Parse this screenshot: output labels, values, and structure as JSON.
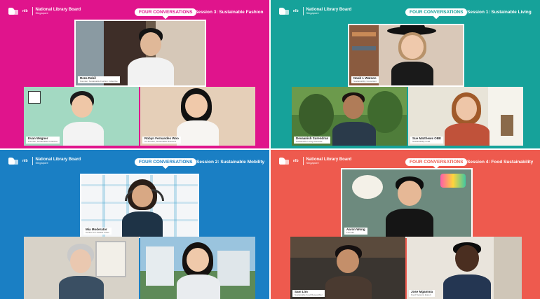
{
  "brand": {
    "badge": "nlb",
    "name": "National Library Board",
    "sub": "Singapore"
  },
  "tag_label": "FOUR CONVERSATIONS",
  "panels": [
    {
      "session": "Session 3: Sustainable Fashion",
      "bg": "#e0148c",
      "tag_color": "#e0148c",
      "participants": [
        {
          "name": "Reza Rahil",
          "role": "Founder, Sustainable Fashion Collective"
        },
        {
          "name": "Evan Wegner",
          "role": "Founder, Sustainable Collective"
        },
        {
          "name": "Robyn Fernandes Woo",
          "role": "Co-founder, Sustainable Business"
        }
      ]
    },
    {
      "session": "Session 1: Sustainable Living",
      "bg": "#16a29a",
      "tag_color": "#16a29a",
      "participants": [
        {
          "name": "Noah L Watson",
          "role": "Sustainability Consultant"
        },
        {
          "name": "Devaanish Surendran",
          "role": "Sustainable Living Advocate"
        },
        {
          "name": "Sue Matthews OBE",
          "role": "Sustainability Lead"
        }
      ]
    },
    {
      "session": "Session 2: Sustainable Mobility",
      "bg": "#1a7fc4",
      "tag_color": "#1a7fc4",
      "participants": [
        {
          "name": "Mia Moderator",
          "role": "Centre for Liveable Cities"
        },
        {
          "name": "",
          "role": ""
        },
        {
          "name": "",
          "role": ""
        }
      ]
    },
    {
      "session": "Session 4: Food Sustainability",
      "bg": "#ee5a4e",
      "tag_color": "#ee5a4e",
      "participants": [
        {
          "name": "Aaron Wong",
          "role": "Founder"
        },
        {
          "name": "Sam Lim",
          "role": "Sustainable Food Researcher"
        },
        {
          "name": "Jose Mgamma",
          "role": "Food Systems Expert"
        }
      ]
    }
  ]
}
